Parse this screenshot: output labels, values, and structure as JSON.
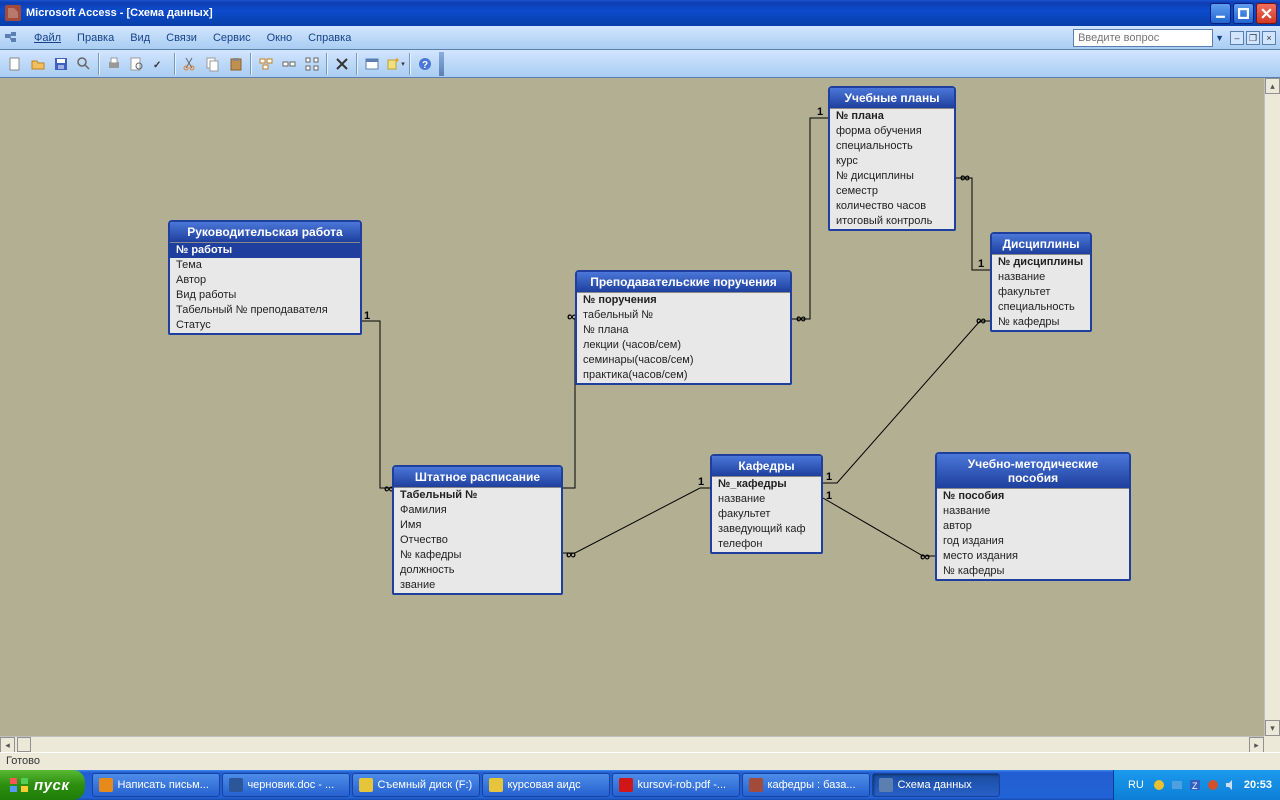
{
  "app": {
    "title": "Microsoft Access - [Схема данных]",
    "ask_placeholder": "Введите вопрос"
  },
  "menus": {
    "file": "Файл",
    "edit": "Правка",
    "view": "Вид",
    "links": "Связи",
    "service": "Сервис",
    "window": "Окно",
    "help": "Справка"
  },
  "tables": {
    "rukov": {
      "title": "Руководительская работа",
      "fields": [
        "№ работы",
        "Тема",
        "Автор",
        "Вид работы",
        "Табельный № преподавателя",
        "Статус"
      ],
      "pk": 0,
      "selected": 0
    },
    "plans": {
      "title": "Учебные планы",
      "fields": [
        "№ плана",
        "форма обучения",
        "специальность",
        "курс",
        "№ дисциплины",
        "семестр",
        "количество часов",
        "итоговый контроль"
      ],
      "pk": 0
    },
    "disc": {
      "title": "Дисциплины",
      "fields": [
        "№ дисциплины",
        "название",
        "факультет",
        "специальность",
        "№ кафедры"
      ],
      "pk": 0
    },
    "prep": {
      "title": "Преподавательские поручения",
      "fields": [
        "№ поручения",
        "табельный №",
        "№ плана",
        "лекции (часов/сем)",
        "семинары(часов/сем)",
        "практика(часов/сем)"
      ],
      "pk": 0
    },
    "shtat": {
      "title": "Штатное расписание",
      "fields": [
        "Табельный №",
        "Фамилия",
        "Имя",
        "Отчество",
        "№ кафедры",
        "должность",
        "звание"
      ],
      "pk": 0
    },
    "kaf": {
      "title": "Кафедры",
      "fields": [
        "№_кафедры",
        "название",
        "факультет",
        "заведующий каф",
        "телефон"
      ],
      "pk": 0
    },
    "posob": {
      "title": "Учебно-методические пособия",
      "fields": [
        "№ пособия",
        "название",
        "автор",
        "год издания",
        "место издания",
        "№  кафедры"
      ],
      "pk": 0
    }
  },
  "status": "Готово",
  "taskbar": {
    "start": "пуск",
    "items": [
      {
        "label": "Написать письм...",
        "icon": "#e68a1c"
      },
      {
        "label": "черновик.doc - ...",
        "icon": "#2b579a"
      },
      {
        "label": "Съемный диск (F:)",
        "icon": "#e6c53b"
      },
      {
        "label": "курсовая аидс",
        "icon": "#e6c53b"
      },
      {
        "label": "kursovi-rob.pdf -...",
        "icon": "#d01616"
      },
      {
        "label": "кафедры : база...",
        "icon": "#a24b3b"
      },
      {
        "label": "Схема данных",
        "icon": "#5a7fb0",
        "active": true
      }
    ],
    "lang": "RU",
    "clock": "20:53"
  }
}
